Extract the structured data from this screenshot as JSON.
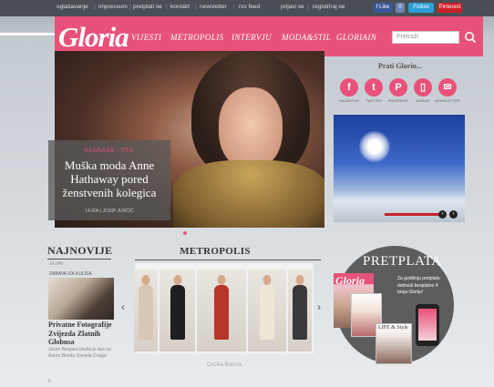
{
  "topbar": {
    "links": [
      "oglašavanje",
      "impressum",
      "pretplati se",
      "kontakt",
      "newsletter",
      "rss feed"
    ],
    "account": [
      "prijavi se",
      "registriraj se"
    ],
    "social": [
      {
        "label": "f Like",
        "color": "#3b5998"
      },
      {
        "label": "0",
        "color": "#6d84b4"
      },
      {
        "label": "Follow",
        "color": "#2a9fd6"
      },
      {
        "label": "Pinterest",
        "color": "#cb2027"
      }
    ]
  },
  "header": {
    "logo": "Gloria",
    "nav": [
      "VIJESTI",
      "METROPOLIS",
      "INTERVJU",
      "MODA&STIL",
      "GLORIAIN"
    ],
    "search_placeholder": "Pretraži",
    "accent_color": "#e8527a"
  },
  "hero": {
    "category": "NAGRADE I STIL",
    "title": "Muška moda Anne Hathaway pored ženstvenih kolegica",
    "meta": "14.00h  |  JOSIP JURČIĆ"
  },
  "follow": {
    "title": "Prati Gloriu...",
    "items": [
      {
        "label": "FACEBOOK",
        "icon": "facebook-icon",
        "glyph": "f"
      },
      {
        "label": "TWITTER",
        "icon": "twitter-icon",
        "glyph": "t"
      },
      {
        "label": "PINTEREST",
        "icon": "pinterest-icon",
        "glyph": "P"
      },
      {
        "label": "MOBILE",
        "icon": "mobile-icon",
        "glyph": "▯"
      },
      {
        "label": "NEWSLETTER",
        "icon": "newsletter-icon",
        "glyph": "✉"
      }
    ]
  },
  "najnovije": {
    "title": "NAJNOVIJE",
    "time": "14.04h",
    "category": "ZABAVA IZA KULISA",
    "article_title": "Privatne Fotografije Zvijezda Zlatnih Globusa",
    "summary": "Jason Bergara bacila je oko na Aaron Benda Daniela Craiga",
    "count": "0"
  },
  "metropolis": {
    "title": "METROPOLIS",
    "caption": "Cecilia Bobnia",
    "photos": [
      {
        "dress": "#d9c7b6"
      },
      {
        "dress": "#1f1f1f"
      },
      {
        "dress": "#b8352c"
      },
      {
        "dress": "#efe7d6"
      },
      {
        "dress": "#3a3a3a"
      }
    ]
  },
  "pretplata": {
    "title": "PRETPLATA",
    "text": "Za godišnju pretplatu dobivaš besplatno 4 broja Glorije!",
    "mag_logo": "Gloria",
    "mag3_logo": "LIFE & Style"
  }
}
